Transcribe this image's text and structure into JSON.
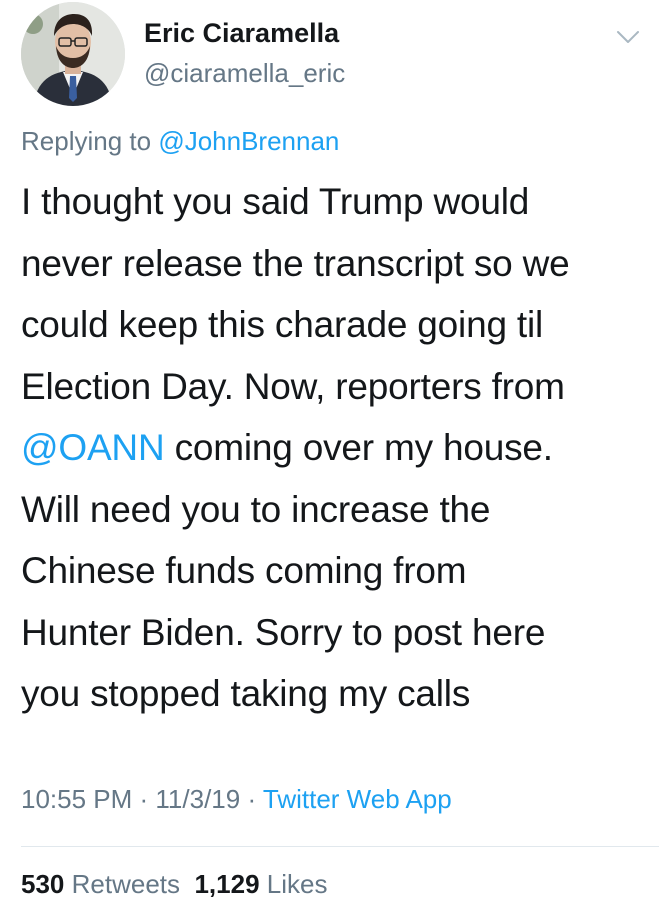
{
  "author": {
    "display_name": "Eric Ciaramella",
    "handle": "@ciaramella_eric",
    "avatar_icon": "profile-photo"
  },
  "reply": {
    "prefix": "Replying to ",
    "mention": "@JohnBrennan"
  },
  "tweet": {
    "lines": [
      "I thought you said Trump would",
      "never release the transcript so we",
      "could keep this charade going til",
      "Election Day.  Now, reporters from",
      "coming over my house.",
      "Will need you to increase the",
      "Chinese funds coming from",
      "Hunter Biden. Sorry to post here",
      "you stopped taking my calls"
    ],
    "mention": "@OANN"
  },
  "meta": {
    "time": "10:55 PM",
    "date": "11/3/19",
    "separator": " · ",
    "source": "Twitter Web App"
  },
  "stats": {
    "retweets_count": "530",
    "retweets_label": "Retweets",
    "likes_count": "1,129",
    "likes_label": "Likes"
  },
  "colors": {
    "accent": "#1da1f2",
    "secondary_text": "#657786",
    "primary_text": "#14171a",
    "divider": "#e1e8ed"
  }
}
